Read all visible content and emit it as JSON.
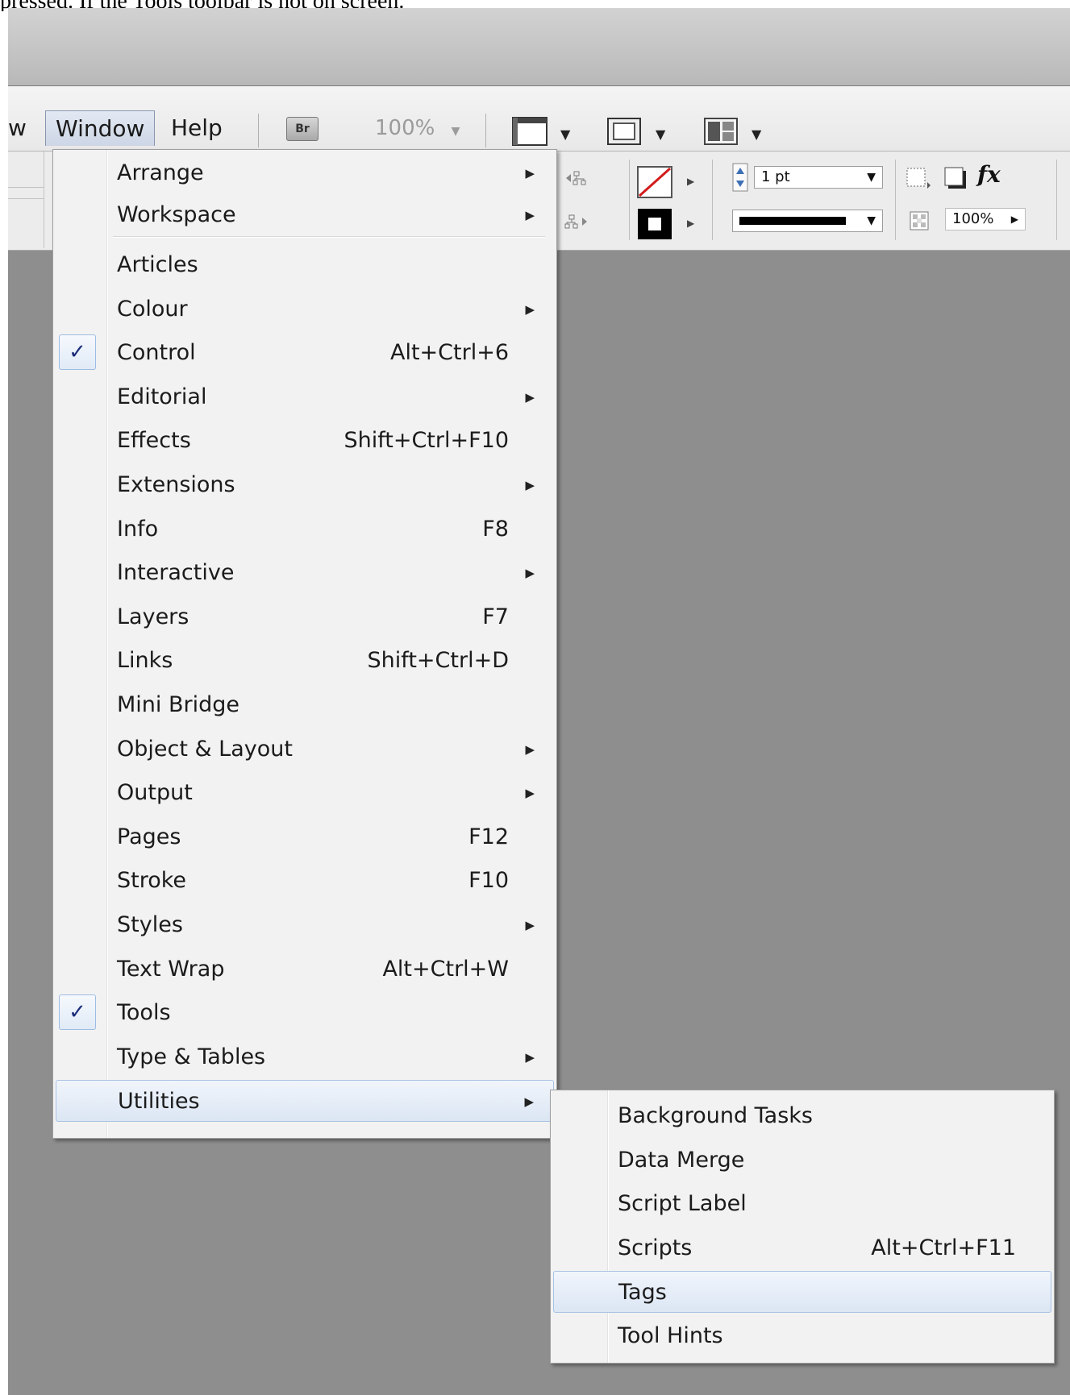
{
  "caption": "pressed. If the Tools toolbar is not on screen.",
  "menubar": {
    "partial_item": "w",
    "window": "Window",
    "help": "Help",
    "bridge": "Br",
    "zoom": "100%"
  },
  "control": {
    "stroke_weight": "1 pt",
    "opacity": "100%",
    "fx": "fx"
  },
  "window_menu": {
    "items": [
      {
        "label": "Arrange",
        "shortcut": "",
        "submenu": true,
        "checked": false
      },
      {
        "label": "Workspace",
        "shortcut": "",
        "submenu": true,
        "checked": false
      },
      {
        "label": "Articles",
        "shortcut": "",
        "submenu": false,
        "checked": false
      },
      {
        "label": "Colour",
        "shortcut": "",
        "submenu": true,
        "checked": false
      },
      {
        "label": "Control",
        "shortcut": "Alt+Ctrl+6",
        "submenu": false,
        "checked": true
      },
      {
        "label": "Editorial",
        "shortcut": "",
        "submenu": true,
        "checked": false
      },
      {
        "label": "Effects",
        "shortcut": "Shift+Ctrl+F10",
        "submenu": false,
        "checked": false
      },
      {
        "label": "Extensions",
        "shortcut": "",
        "submenu": true,
        "checked": false
      },
      {
        "label": "Info",
        "shortcut": "F8",
        "submenu": false,
        "checked": false
      },
      {
        "label": "Interactive",
        "shortcut": "",
        "submenu": true,
        "checked": false
      },
      {
        "label": "Layers",
        "shortcut": "F7",
        "submenu": false,
        "checked": false
      },
      {
        "label": "Links",
        "shortcut": "Shift+Ctrl+D",
        "submenu": false,
        "checked": false
      },
      {
        "label": "Mini Bridge",
        "shortcut": "",
        "submenu": false,
        "checked": false
      },
      {
        "label": "Object & Layout",
        "shortcut": "",
        "submenu": true,
        "checked": false
      },
      {
        "label": "Output",
        "shortcut": "",
        "submenu": true,
        "checked": false
      },
      {
        "label": "Pages",
        "shortcut": "F12",
        "submenu": false,
        "checked": false
      },
      {
        "label": "Stroke",
        "shortcut": "F10",
        "submenu": false,
        "checked": false
      },
      {
        "label": "Styles",
        "shortcut": "",
        "submenu": true,
        "checked": false
      },
      {
        "label": "Text Wrap",
        "shortcut": "Alt+Ctrl+W",
        "submenu": false,
        "checked": false
      },
      {
        "label": "Tools",
        "shortcut": "",
        "submenu": false,
        "checked": true
      },
      {
        "label": "Type & Tables",
        "shortcut": "",
        "submenu": true,
        "checked": false
      },
      {
        "label": "Utilities",
        "shortcut": "",
        "submenu": true,
        "checked": false,
        "highlighted": true
      }
    ]
  },
  "utilities_menu": {
    "items": [
      {
        "label": "Background Tasks",
        "shortcut": ""
      },
      {
        "label": "Data Merge",
        "shortcut": ""
      },
      {
        "label": "Script Label",
        "shortcut": ""
      },
      {
        "label": "Scripts",
        "shortcut": "Alt+Ctrl+F11"
      },
      {
        "label": "Tags",
        "shortcut": "",
        "highlighted": true
      },
      {
        "label": "Tool Hints",
        "shortcut": ""
      }
    ]
  },
  "colors": {
    "workspace": "#8e8e8e",
    "menu_bg": "#f2f2f2",
    "highlight_border": "#a9c2e3",
    "check_color": "#1c2d7a"
  },
  "icons": {
    "submenu_arrow": "submenu-arrow-icon",
    "check": "checkmark-icon",
    "screen_mode": "screen-mode-icon",
    "view_options": "view-options-icon",
    "arrange_documents": "arrange-documents-icon"
  }
}
